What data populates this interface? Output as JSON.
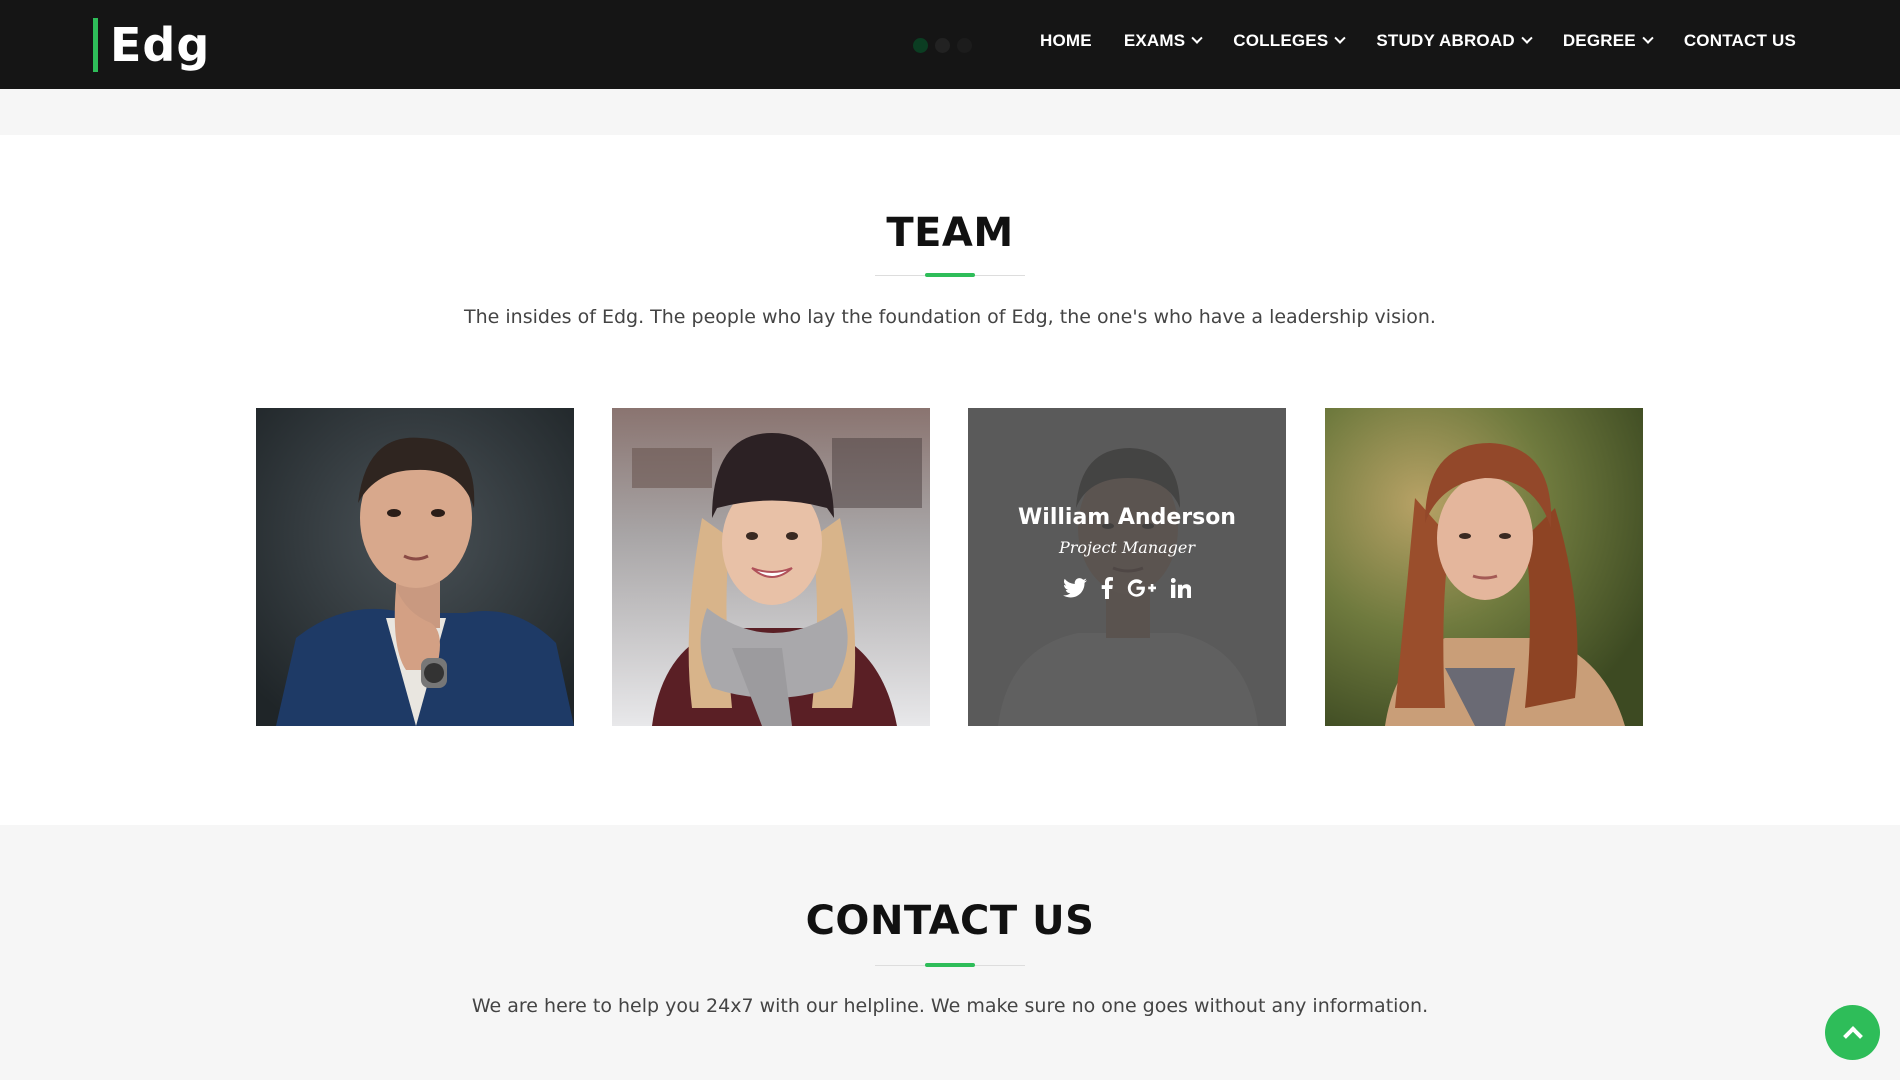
{
  "header": {
    "logo": "Edg",
    "nav": [
      {
        "label": "HOME",
        "dropdown": false
      },
      {
        "label": "EXAMS",
        "dropdown": true
      },
      {
        "label": "COLLEGES",
        "dropdown": true
      },
      {
        "label": "STUDY ABROAD",
        "dropdown": true
      },
      {
        "label": "DEGREE",
        "dropdown": true
      },
      {
        "label": "CONTACT US",
        "dropdown": false
      }
    ]
  },
  "team": {
    "title": "TEAM",
    "subtitle": "The insides of Edg. The people who lay the foundation of Edg, the one's who have a leadership vision.",
    "members": [
      {
        "photo": "man-in-blue-suit-photo"
      },
      {
        "photo": "woman-in-beanie-and-scarf-photo"
      },
      {
        "photo": "man-in-white-shirt-photo",
        "name": "William Anderson",
        "role": "Project Manager",
        "socials": [
          "twitter-icon",
          "facebook-icon",
          "google-plus-icon",
          "linkedin-icon"
        ]
      },
      {
        "photo": "woman-with-auburn-hair-photo"
      }
    ]
  },
  "contact": {
    "title": "CONTACT US",
    "subtitle": "We are here to help you 24x7 with our helpline. We make sure no one goes without any information."
  },
  "colors": {
    "accent": "#2ebd59",
    "header_bg": "#151515",
    "section_bg": "#f6f6f6"
  }
}
